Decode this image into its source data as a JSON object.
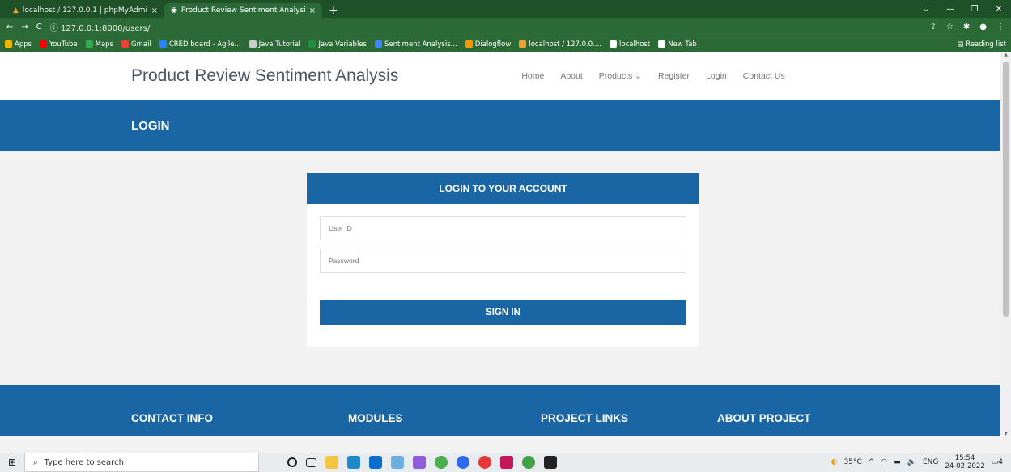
{
  "browser": {
    "tabs": [
      {
        "title": "localhost / 127.0.0.1 | phpMyAdmin",
        "close": "×",
        "favicon_color": "#f0a030"
      },
      {
        "title": "Product Review Sentiment Analysis",
        "close": "×",
        "favicon_color": "#ffffff"
      }
    ],
    "new_tab": "+",
    "url_prefix": "ⓘ",
    "url": "127.0.0.1:8000/users/",
    "bookmarks": [
      {
        "label": "Apps",
        "color": "#f4b400"
      },
      {
        "label": "YouTube",
        "color": "#ff0000"
      },
      {
        "label": "Maps",
        "color": "#34a853"
      },
      {
        "label": "Gmail",
        "color": "#ea4335"
      },
      {
        "label": "CRED board - Agile...",
        "color": "#2684ff"
      },
      {
        "label": "Java Tutorial",
        "color": "#cccccc"
      },
      {
        "label": "Java Variables",
        "color": "#1e8e3e"
      },
      {
        "label": "Sentiment Analysis...",
        "color": "#4285f4"
      },
      {
        "label": "Dialogflow",
        "color": "#ff9800"
      },
      {
        "label": "localhost / 127.0.0....",
        "color": "#f0a030"
      },
      {
        "label": "localhost",
        "color": "#ffffff"
      },
      {
        "label": "New Tab",
        "color": "#ffffff"
      }
    ],
    "reading_list": "Reading list"
  },
  "site": {
    "brand": "Product Review Sentiment Analysis",
    "nav": [
      "Home",
      "About",
      "Products ⌄",
      "Register",
      "Login",
      "Contact Us"
    ],
    "banner_title": "LOGIN"
  },
  "login": {
    "heading": "LOGIN TO YOUR ACCOUNT",
    "userid_placeholder": "User ID",
    "password_placeholder": "Password",
    "signin_label": "SIGN IN"
  },
  "footer": {
    "headings": [
      "CONTACT INFO",
      "MODULES",
      "PROJECT LINKS",
      "ABOUT PROJECT"
    ]
  },
  "taskbar": {
    "search_placeholder": "Type here to search",
    "weather": "35°C",
    "language": "ENG",
    "time": "15:54",
    "date": "24-02-2022",
    "notifications": "4"
  },
  "colors": {
    "brand_blue": "#1a65a3",
    "chrome_green": "#1e5128"
  }
}
